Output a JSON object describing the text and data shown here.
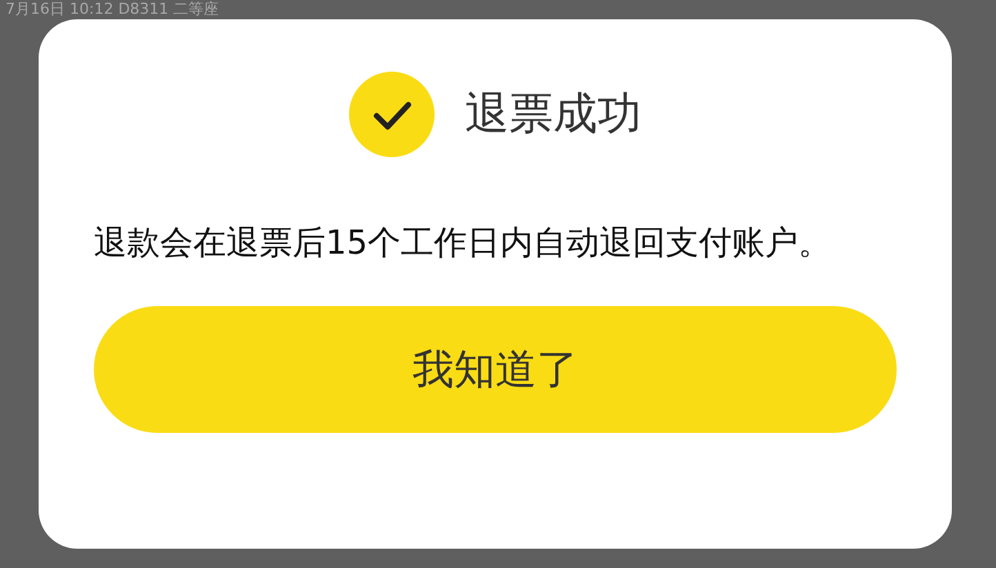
{
  "background_text": "7月16日 10:12 D8311 二等座",
  "dialog": {
    "title": "退票成功",
    "message": "退款会在退票后15个工作日内自动退回支付账户。",
    "button": "我知道了"
  }
}
